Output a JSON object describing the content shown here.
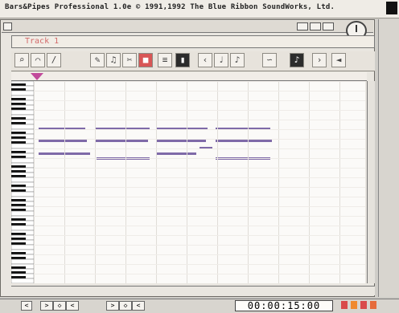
{
  "app": {
    "screen_title": "Bars&Pipes Professional 1.0e  © 1991,1992 The Blue Ribbon SoundWorks, Ltd."
  },
  "inner_window": {
    "title": "Track 1"
  },
  "toolbar": {
    "tools": [
      "magnifier",
      "curve",
      "line",
      "pencil",
      "notes",
      "scissors",
      "color-swatch",
      "mixer",
      "piano",
      "note-left",
      "quarter-note",
      "eighth-note",
      "draw",
      "black-note",
      "pointer",
      "speaker"
    ]
  },
  "status": {
    "time_display": "00:00:15:00"
  },
  "colors": {
    "accent": "#c14b9b",
    "note": "#7f6aa8",
    "red": "#d85656"
  }
}
